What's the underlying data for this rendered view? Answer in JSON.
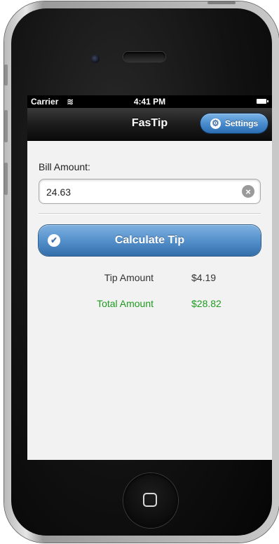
{
  "status_bar": {
    "carrier": "Carrier",
    "time": "4:41 PM",
    "icons": [
      "wifi-icon",
      "battery-icon"
    ]
  },
  "navbar": {
    "title": "FasTip",
    "settings_label": "Settings",
    "settings_icon": "gear-icon"
  },
  "form": {
    "bill_label": "Bill Amount:",
    "bill_value": "24.63",
    "clear_icon": "clear-icon"
  },
  "actions": {
    "calculate_label": "Calculate Tip",
    "calculate_icon": "check-icon"
  },
  "results": {
    "tip_label": "Tip Amount",
    "tip_value": "$4.19",
    "total_label": "Total Amount",
    "total_value": "$28.82"
  },
  "colors": {
    "accent_blue": "#4a8dcf",
    "total_green": "#1f9a1f",
    "screen_background": "#f2f2f2"
  }
}
